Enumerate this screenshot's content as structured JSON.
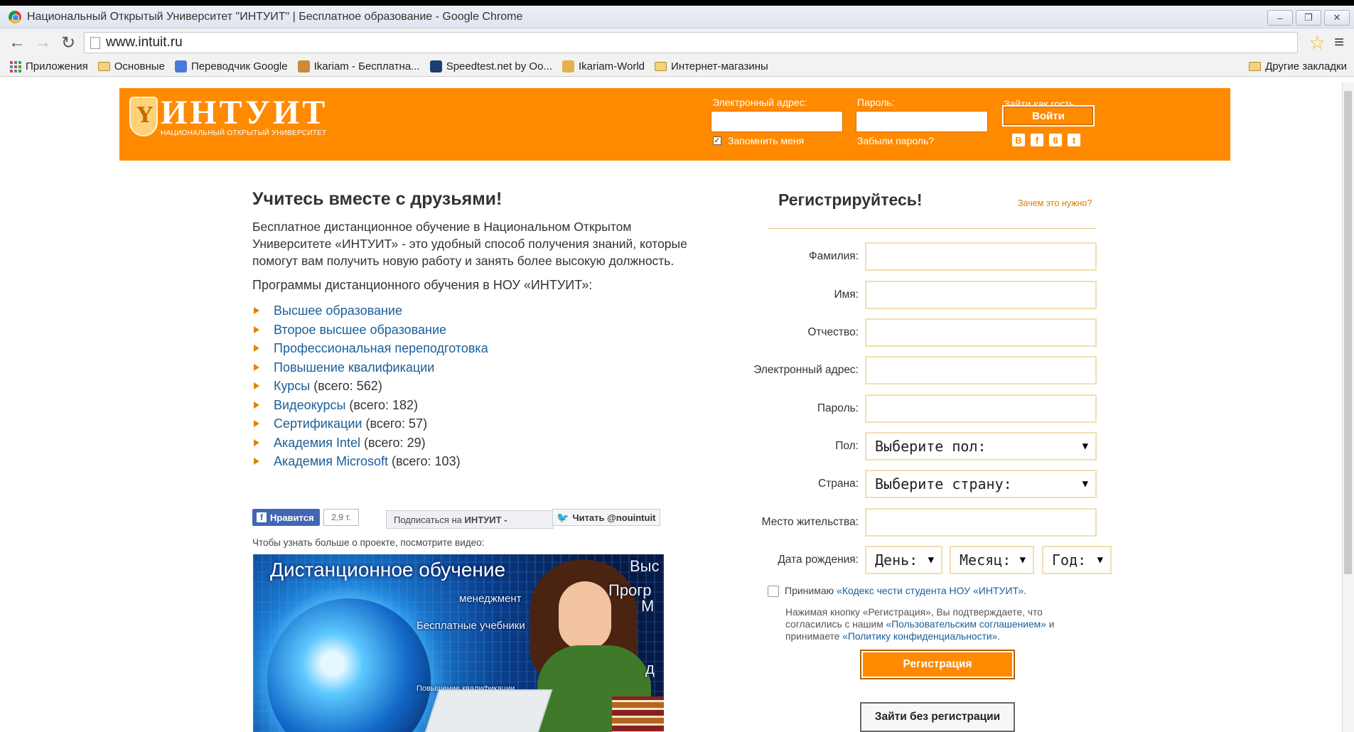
{
  "window": {
    "title": "Национальный Открытый Университет \"ИНТУИТ\" | Бесплатное образование - Google Chrome",
    "controls": [
      "–",
      "❐",
      "✕"
    ]
  },
  "toolbar": {
    "url": "www.intuit.ru"
  },
  "bookmarks": {
    "items": [
      "Приложения",
      "Основные",
      "Переводчик Google",
      "Ikariam - Бесплатна...",
      "Speedtest.net by Oo...",
      "Ikariam-World",
      "Интернет-магазины"
    ],
    "other": "Другие закладки"
  },
  "header": {
    "logo_text": "ИНТУИТ",
    "logo_sub": "НАЦИОНАЛЬНЫЙ ОТКРЫТЫЙ УНИВЕРСИТЕТ",
    "email_label": "Электронный адрес:",
    "password_label": "Пароль:",
    "guest_label": "Зайти как гость",
    "login_button": "Войти",
    "remember_label": "Запомнить меня",
    "remember_checked": true,
    "forgot_label": "Забыли пароль?",
    "social": [
      "В",
      "f",
      "8",
      "t"
    ]
  },
  "left": {
    "heading": "Учитесь вместе с друзьями!",
    "intro": "Бесплатное дистанционное обучение в Национальном Открытом Университете «ИНТУИТ» - это удобный способ получения знаний, которые помогут вам получить новую работу и занять более высокую должность.",
    "programs_title": "Программы дистанционного обучения в НОУ «ИНТУИТ»:",
    "programs": [
      {
        "label": "Высшее образование",
        "count": ""
      },
      {
        "label": "Второе высшее образование",
        "count": ""
      },
      {
        "label": "Профессиональная переподготовка",
        "count": ""
      },
      {
        "label": "Повышение квалификации",
        "count": ""
      },
      {
        "label": "Курсы",
        "count": "(всего: 562)"
      },
      {
        "label": "Видеокурсы",
        "count": "(всего: 182)"
      },
      {
        "label": "Сертификации",
        "count": "(всего: 57)"
      },
      {
        "label": "Академия Intel",
        "count": "(всего: 29)"
      },
      {
        "label": "Академия Microsoft",
        "count": "(всего: 103)"
      }
    ],
    "fb_like": "Нравится",
    "fb_count": "2,9 т.",
    "subscribe_text": "Подписаться на",
    "subscribe_brand": "ИНТУИТ -",
    "twitter_text": "Читать @nouintuit",
    "video_note": "Чтобы узнать больше о проекте, посмотрите видео:",
    "video": {
      "title": "Дистанционное обучение",
      "words": [
        "менеджмент",
        "Бесплатные учебники",
        "Повышение квалификации",
        "Выс",
        "Прогр",
        "М",
        "д"
      ]
    }
  },
  "registration": {
    "title": "Регистрируйтесь!",
    "why_link": "Зачем это нужно?",
    "fields": {
      "last_name": "Фамилия:",
      "first_name": "Имя:",
      "patronymic": "Отчество:",
      "email": "Электронный адрес:",
      "password": "Пароль:",
      "gender": "Пол:",
      "country": "Страна:",
      "residence": "Место жительства:",
      "birthdate": "Дата рождения:"
    },
    "gender_select": "Выберите пол:",
    "country_select": "Выберите страну:",
    "day_select": "День:",
    "month_select": "Месяц:",
    "year_select": "Год:",
    "terms_prefix": "Принимаю",
    "terms_link": "«Кодекс чести студента НОУ «ИНТУИТ».",
    "notice_prefix": "Нажимая кнопку «Регистрация», Вы подтверждаете, что согласились с нашим",
    "notice_link1": "«Пользовательским соглашением»",
    "notice_mid": "и принимаете",
    "notice_link2": "«Политику конфиденциальности».",
    "register_button": "Регистрация",
    "guest_button": "Зайти без регистрации"
  }
}
